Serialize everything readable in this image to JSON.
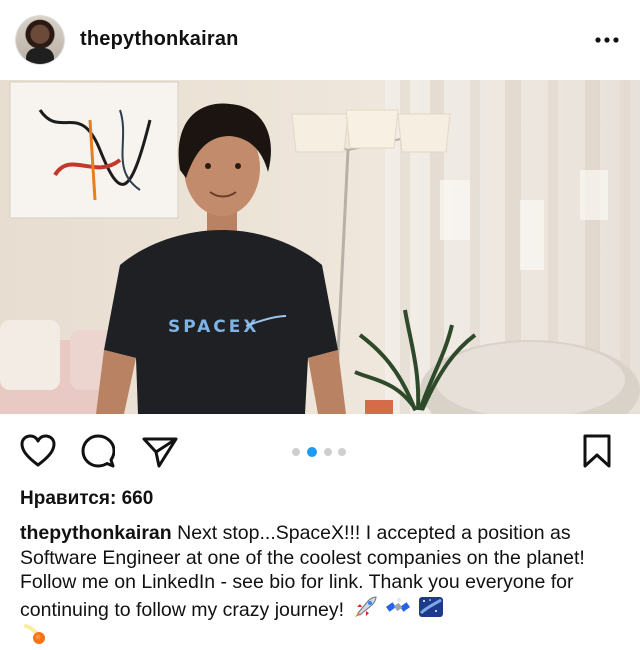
{
  "post": {
    "username": "thepythonkairan",
    "likes_text": "Нравится: 660",
    "caption": {
      "username": "thepythonkairan",
      "text": "Next stop...SpaceX!!! I accepted a position as Software Engineer at one of the coolest companies on the planet! Follow me on LinkedIn - see bio for link. Thank you everyone for continuing to follow my crazy journey!"
    },
    "shirt_logo": "SPACEX",
    "carousel": {
      "count": 4,
      "active": 2
    }
  },
  "icons": {
    "more": "more-options-icon",
    "like": "heart-icon",
    "comment": "comment-bubble-icon",
    "share": "paper-plane-icon",
    "save": "bookmark-icon"
  },
  "colors": {
    "active_dot": "#1d9bf0",
    "inactive_dot": "#cfcfcf"
  }
}
